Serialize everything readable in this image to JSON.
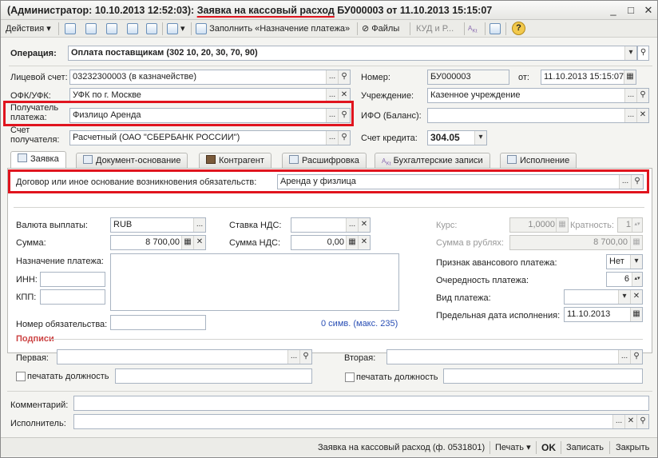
{
  "window": {
    "title_prefix": "(Администратор: 10.10.2013 12:52:03):",
    "title_doc": "Заявка на кассовый расход",
    "title_suffix": "БУ000003 от 11.10.2013 15:15:07",
    "min": "_",
    "max": "□",
    "close": "✕"
  },
  "toolbar": {
    "actions": "Действия ▾",
    "fill": "Заполнить «Назначение платежа»",
    "files": "Файлы",
    "kud": "КУД и Р...",
    "help": "?"
  },
  "header": {
    "operation_label": "Операция:",
    "operation_value": "Оплата поставщикам (302 10, 20, 30, 70, 90)",
    "account_label": "Лицевой счет:",
    "account_value": "03232300003 (в казначействе)",
    "number_label": "Номер:",
    "number_value": "БУ000003",
    "from_label": "от:",
    "date_value": "11.10.2013 15:15:07",
    "ofk_label": "ОФК/УФК:",
    "ofk_value": "УФК по г. Москве",
    "institution_label": "Учреждение:",
    "institution_value": "Казенное учреждение",
    "recipient_label_1": "Получатель",
    "recipient_label_2": "платежа:",
    "recipient_value": "Физлицо Аренда",
    "ifo_label": "ИФО (Баланс):",
    "ifo_value": "",
    "recip_account_label_1": "Счет",
    "recip_account_label_2": "получателя:",
    "recip_account_value": "Расчетный (ОАО \"СБЕРБАНК РОССИИ\")",
    "credit_label": "Счет кредита:",
    "credit_value": "304.05"
  },
  "tabs": [
    "Заявка",
    "Документ-основание",
    "Контрагент",
    "Расшифровка",
    "Бухгалтерские записи",
    "Исполнение"
  ],
  "form": {
    "contract_label": "Договор или иное основание возникновения обязательств:",
    "contract_value": "Аренда у физлица",
    "currency_label": "Валюта выплаты:",
    "currency_value": "RUB",
    "vat_rate_label": "Ставка НДС:",
    "vat_rate_value": "",
    "rate_label": "Курс:",
    "rate_value": "1,0000",
    "multiplicity_label": "Кратность:",
    "multiplicity_value": "1",
    "sum_label": "Сумма:",
    "sum_value": "8 700,00",
    "vat_sum_label": "Сумма НДС:",
    "vat_sum_value": "0,00",
    "sum_rub_label": "Сумма в рублях:",
    "sum_rub_value": "8 700,00",
    "purpose_label": "Назначение платежа:",
    "purpose_value": "",
    "advance_label": "Признак авансового платежа:",
    "advance_value": "Нет",
    "inn_label": "ИНН:",
    "inn_value": "",
    "priority_label": "Очередность платежа:",
    "priority_value": "6",
    "kpp_label": "КПП:",
    "kpp_value": "",
    "payment_type_label": "Вид платежа:",
    "payment_type_value": "",
    "deadline_label": "Предельная дата исполнения:",
    "deadline_value": "11.10.2013",
    "obligation_label": "Номер обязательства:",
    "obligation_value": "",
    "char_count": "0 симв. (макс. 235)",
    "signatures_label": "Подписи",
    "first_label": "Первая:",
    "first_value": "",
    "second_label": "Вторая:",
    "second_value": "",
    "print_position_label": "печатать должность"
  },
  "bottom": {
    "comment_label": "Комментарий:",
    "comment_value": "",
    "executor_label": "Исполнитель:",
    "executor_value": ""
  },
  "statusbar": {
    "print_form": "Заявка на кассовый расход (ф. 0531801)",
    "print": "Печать ▾",
    "ok": "OK",
    "save": "Записать",
    "close": "Закрыть"
  },
  "colors": {
    "highlight": "#e0141e",
    "section_red": "#c44444"
  }
}
